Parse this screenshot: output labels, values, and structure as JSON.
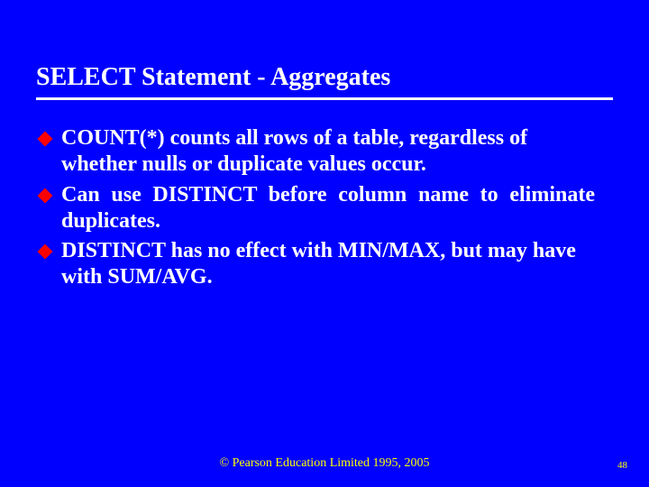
{
  "slide": {
    "title": "SELECT Statement - Aggregates",
    "bullets": [
      "COUNT(*) counts all rows of a table, regardless of whether nulls or duplicate values occur.",
      "Can use DISTINCT before column name to eliminate duplicates.",
      "DISTINCT has no effect with MIN/MAX, but may have with SUM/AVG."
    ],
    "footer": "© Pearson Education Limited 1995, 2005",
    "page_number": "48"
  },
  "colors": {
    "background": "#0000ff",
    "text": "#ffffff",
    "bullet": "#ff0000",
    "footer": "#ffff00"
  }
}
